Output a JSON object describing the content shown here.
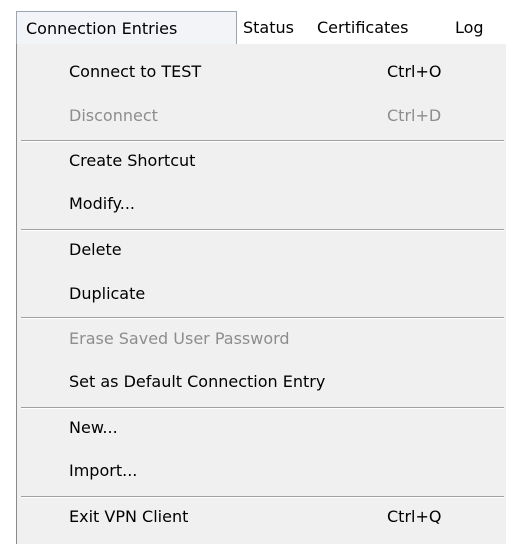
{
  "menubar": {
    "items": [
      {
        "label": "Connection Entries"
      },
      {
        "label": "Status"
      },
      {
        "label": "Certificates"
      },
      {
        "label": "Log"
      }
    ]
  },
  "menu": {
    "connect": {
      "label": "Connect to TEST",
      "shortcut": "Ctrl+O"
    },
    "disconnect": {
      "label": "Disconnect",
      "shortcut": "Ctrl+D"
    },
    "create_shortcut": {
      "label": "Create Shortcut"
    },
    "modify": {
      "label": "Modify..."
    },
    "delete": {
      "label": "Delete"
    },
    "duplicate": {
      "label": "Duplicate"
    },
    "erase_password": {
      "label": "Erase Saved User Password"
    },
    "set_default": {
      "label": "Set as Default Connection Entry"
    },
    "new": {
      "label": "New..."
    },
    "import": {
      "label": "Import..."
    },
    "exit": {
      "label": "Exit VPN Client",
      "shortcut": "Ctrl+Q"
    }
  },
  "colors": {
    "disabled_text": "#8d8d8d",
    "menu_background": "#f0f0f0"
  }
}
